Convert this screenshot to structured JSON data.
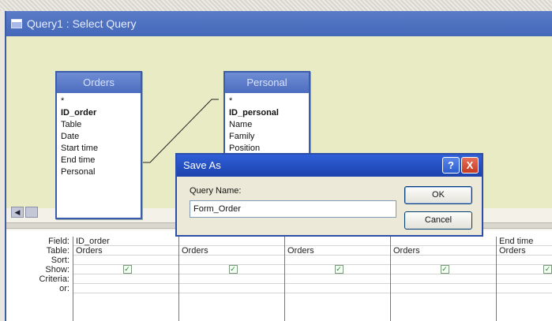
{
  "window": {
    "title": "Query1 : Select Query"
  },
  "tables": [
    {
      "name": "Orders",
      "fields": [
        "*",
        "ID_order",
        "Table",
        "Date",
        "Start time",
        "End time",
        "Personal"
      ]
    },
    {
      "name": "Personal",
      "fields": [
        "*",
        "ID_personal",
        "Name",
        "Family",
        "Position"
      ]
    }
  ],
  "grid": {
    "row_labels": [
      "Field:",
      "Table:",
      "Sort:",
      "Show:",
      "Criteria:",
      "or:"
    ],
    "columns": [
      {
        "field": "ID_order",
        "table": "Orders",
        "show": true
      },
      {
        "field": "",
        "table": "Orders",
        "show": true
      },
      {
        "field": "",
        "table": "Orders",
        "show": true
      },
      {
        "field": "",
        "table": "Orders",
        "show": true
      },
      {
        "field": "End time",
        "table": "Orders",
        "show": true
      }
    ]
  },
  "dialog": {
    "title": "Save As",
    "help_label": "?",
    "close_label": "X",
    "field_label": "Query Name:",
    "input_value": "Form_Order",
    "ok_label": "OK",
    "cancel_label": "Cancel"
  },
  "colors": {
    "title_blue": "#2f5fd8",
    "pane_bg": "#e8ebc4",
    "check_green": "#1a8c1a"
  },
  "icons": [
    "query-window-icon",
    "scroll-left-icon",
    "checkbox-icon",
    "help-icon",
    "close-icon"
  ]
}
